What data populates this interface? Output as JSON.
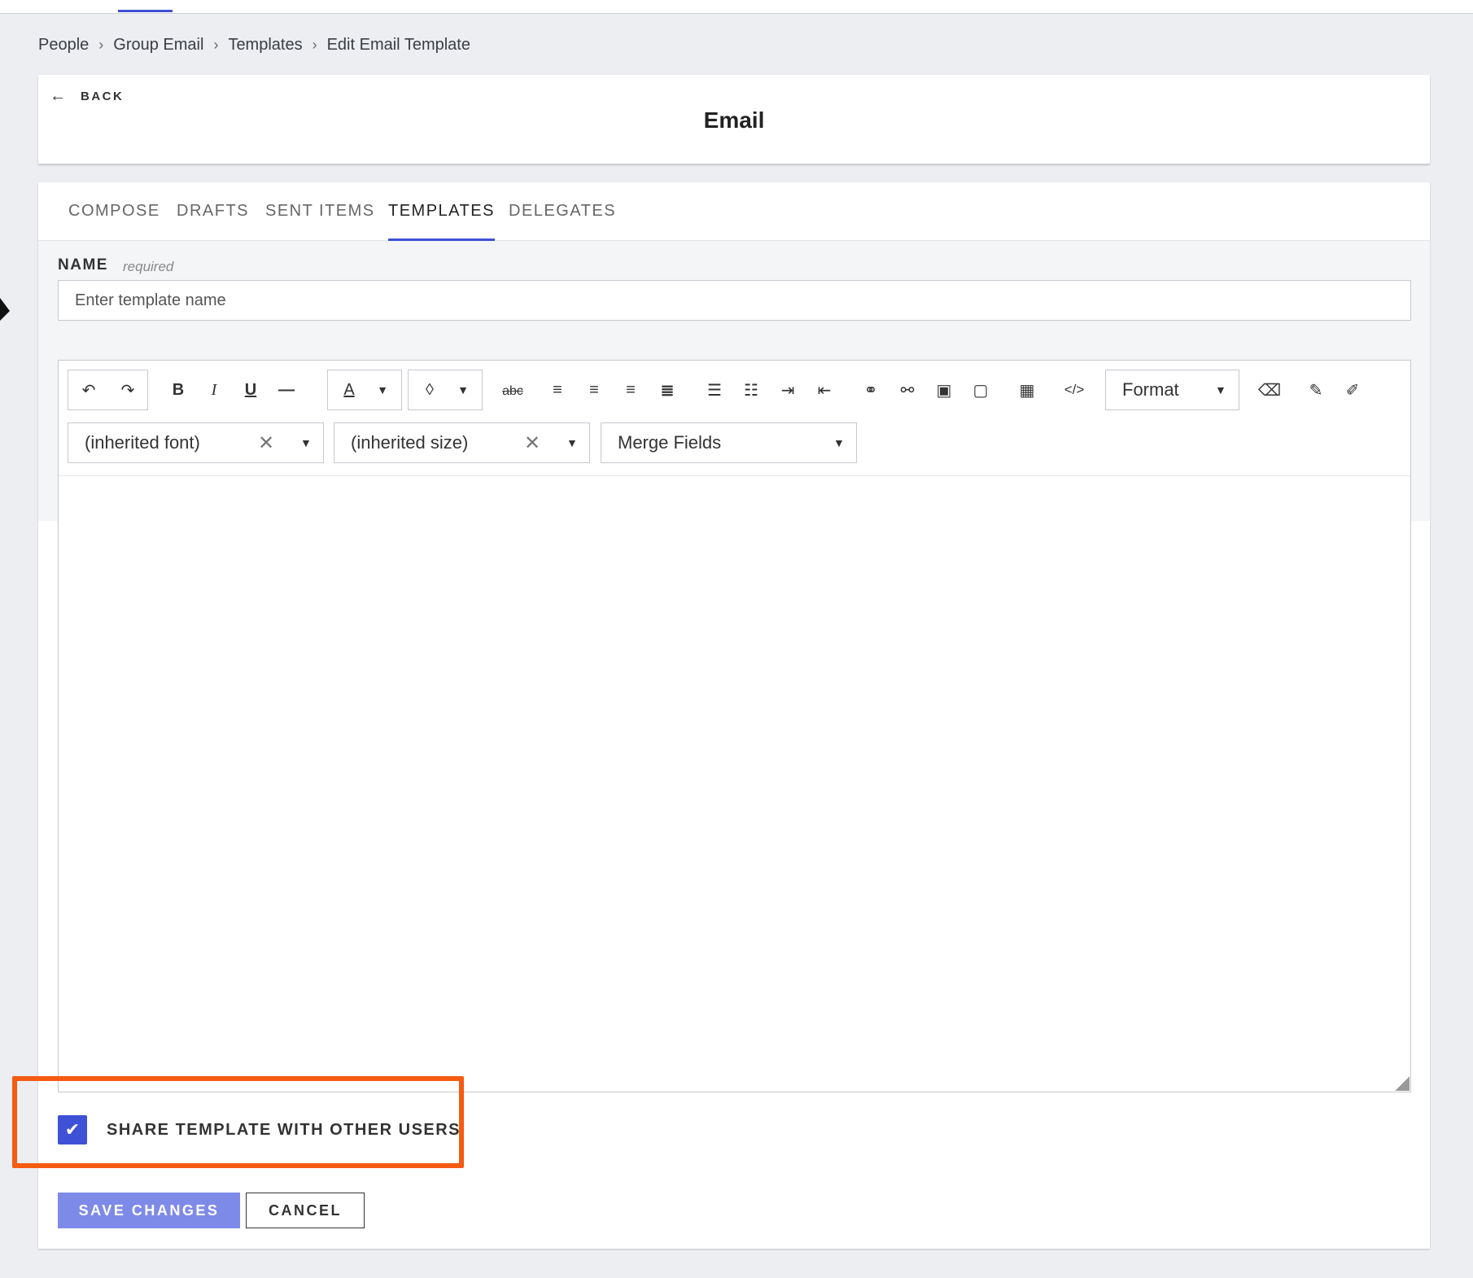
{
  "breadcrumb": [
    "People",
    "Group Email",
    "Templates",
    "Edit Email Template"
  ],
  "header": {
    "back_label": "BACK",
    "title": "Email"
  },
  "tabs": [
    "COMPOSE",
    "DRAFTS",
    "SENT ITEMS",
    "TEMPLATES",
    "DELEGATES"
  ],
  "active_tab": "TEMPLATES",
  "name_field": {
    "label": "NAME",
    "required_hint": "required",
    "placeholder": "Enter template name",
    "value": ""
  },
  "toolbar": {
    "format_label": "Format",
    "font_select": "(inherited font)",
    "size_select": "(inherited size)",
    "merge_fields": "Merge Fields",
    "strikethrough_label": "abc"
  },
  "share": {
    "label": "SHARE TEMPLATE WITH OTHER USERS",
    "checked": true
  },
  "buttons": {
    "save": "SAVE CHANGES",
    "cancel": "CANCEL"
  },
  "colors": {
    "accent": "#3f51d6",
    "save_button": "#7e8ae8",
    "highlight": "#f55b12",
    "background": "#eceef2"
  }
}
